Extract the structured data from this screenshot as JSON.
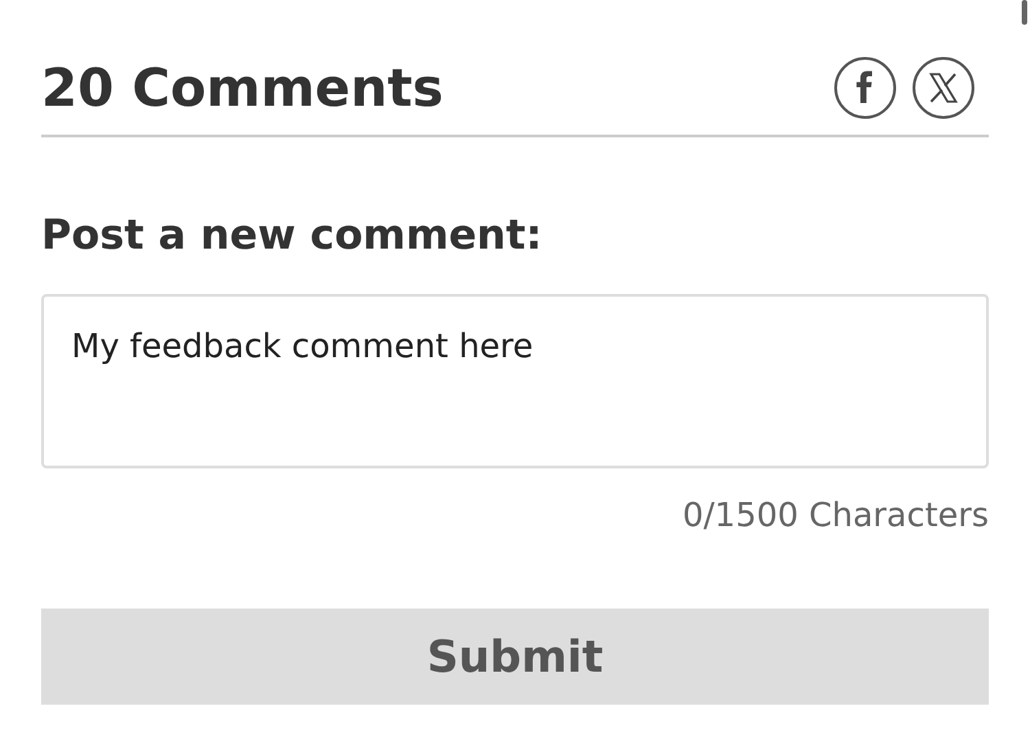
{
  "header": {
    "title": "20 Comments"
  },
  "share_icons": [
    {
      "kind": "facebook"
    },
    {
      "kind": "x"
    }
  ],
  "form": {
    "label": "Post a new comment:",
    "value": "My feedback comment here",
    "counter": "0/1500 Characters",
    "submit": "Submit"
  }
}
